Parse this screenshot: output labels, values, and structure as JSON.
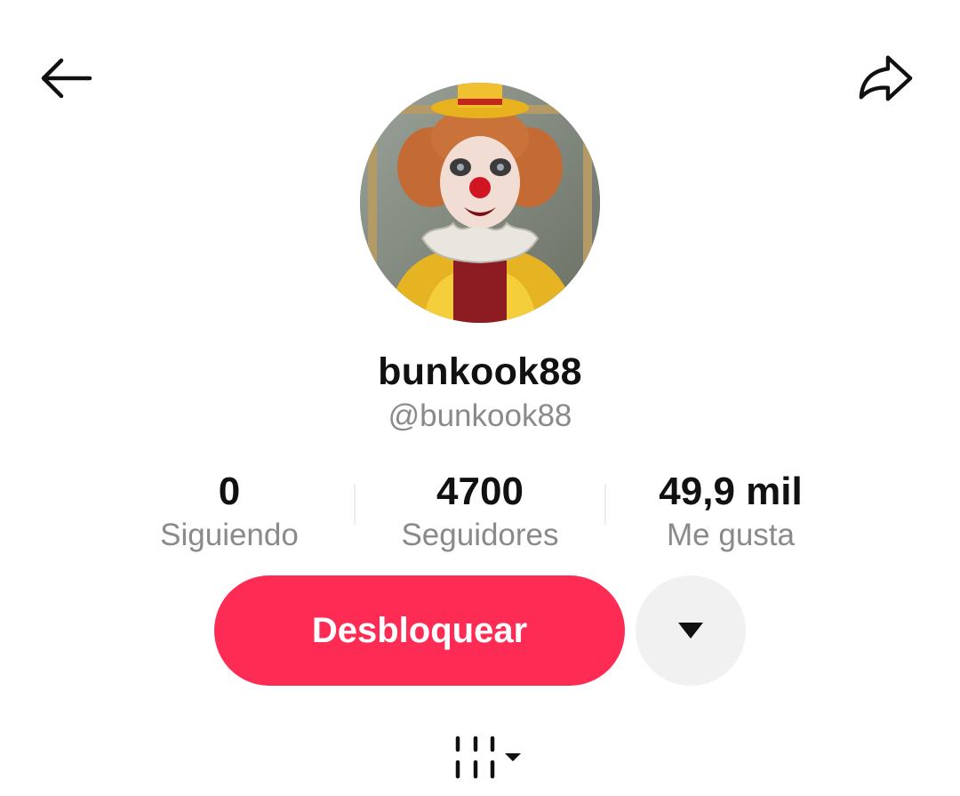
{
  "header": {
    "back_icon": "arrow-left-icon",
    "share_icon": "share-arrow-icon"
  },
  "profile": {
    "avatar_description_icon": "clown-avatar",
    "display_name": "bunkook88",
    "username": "@bunkook88"
  },
  "stats": [
    {
      "value": "0",
      "label": "Siguiendo"
    },
    {
      "value": "4700",
      "label": "Seguidores"
    },
    {
      "value": "49,9 mil",
      "label": "Me gusta"
    }
  ],
  "actions": {
    "unblock_label": "Desbloquear",
    "more_icon": "caret-down-icon"
  },
  "tabs": {
    "videos_icon": "grid-columns-icon"
  },
  "colors": {
    "accent": "#fe2c55",
    "secondary_text": "#8a8a8a",
    "button_gray": "#f1f1f2"
  }
}
